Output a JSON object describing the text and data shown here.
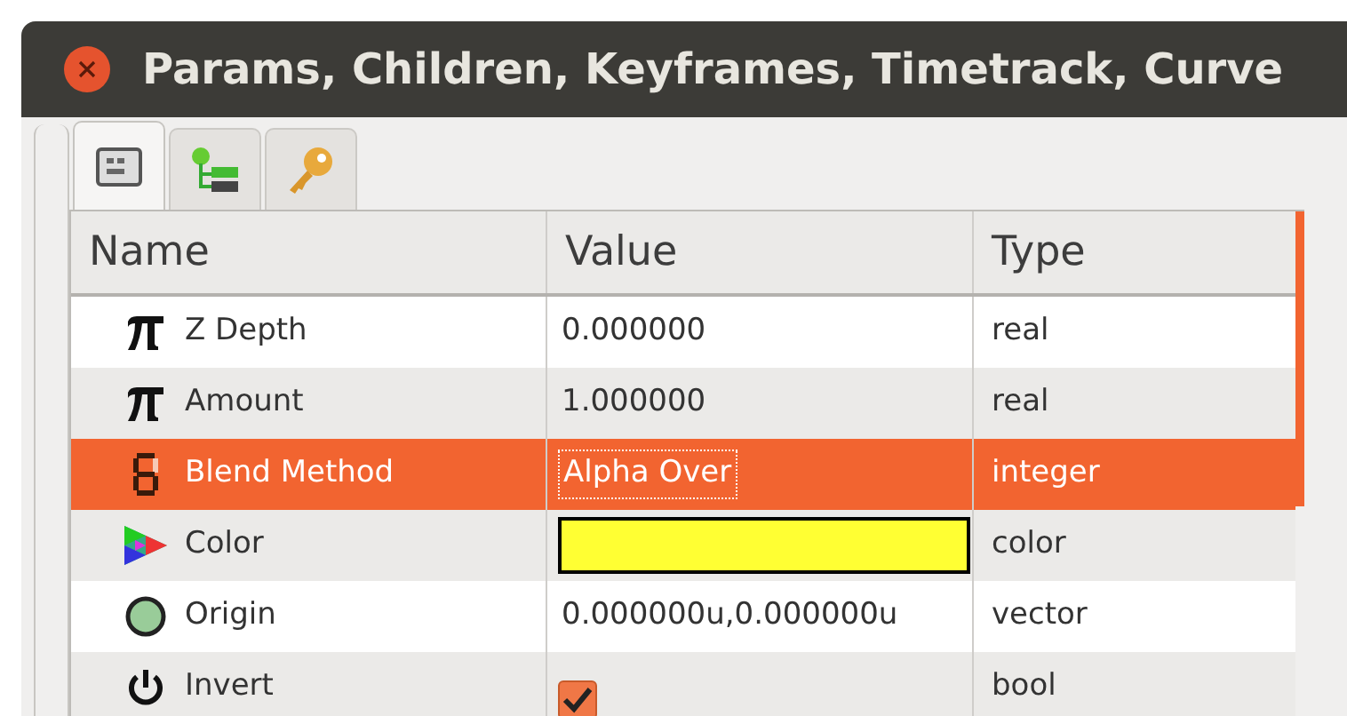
{
  "window": {
    "title": "Params, Children, Keyframes, Timetrack, Curve"
  },
  "tabs": [
    {
      "selected": true
    },
    {
      "selected": false
    },
    {
      "selected": false
    }
  ],
  "table": {
    "columns": [
      "Name",
      "Value",
      "Type"
    ],
    "rows": [
      {
        "kind": "real",
        "name": "Z Depth",
        "value": "0.000000",
        "type": "real",
        "selected": false
      },
      {
        "kind": "real",
        "name": "Amount",
        "value": "1.000000",
        "type": "real",
        "selected": false
      },
      {
        "kind": "integer",
        "name": "Blend Method",
        "value": "Alpha Over",
        "type": "integer",
        "selected": true
      },
      {
        "kind": "color",
        "name": "Color",
        "color": "#ffff33",
        "type": "color",
        "selected": false
      },
      {
        "kind": "vector",
        "name": "Origin",
        "value": "0.000000u,0.000000u",
        "type": "vector",
        "selected": false
      },
      {
        "kind": "bool",
        "name": "Invert",
        "checked": true,
        "type": "bool",
        "selected": false
      }
    ]
  }
}
